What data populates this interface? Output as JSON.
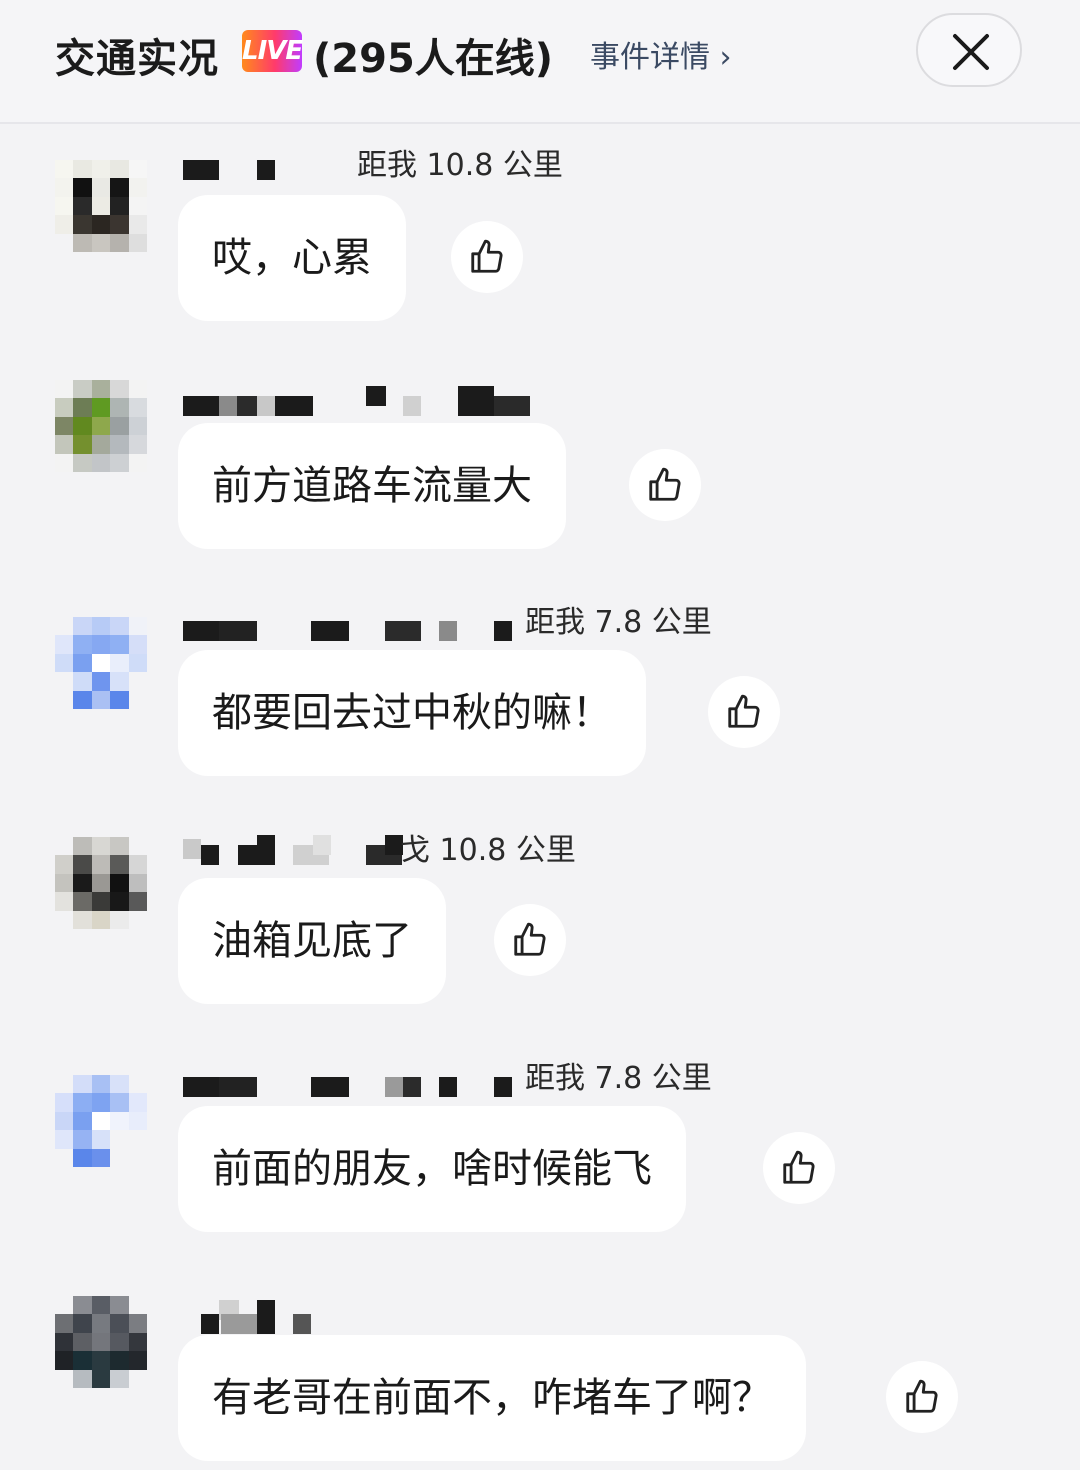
{
  "header": {
    "title": "交通实况",
    "live_badge": "LIVE",
    "online": "(295人在线)",
    "detail_link": "事件详情",
    "detail_chevron": "›",
    "close_icon": "close-icon",
    "live_gradient": [
      "#ff8a1c",
      "#ff3b6b",
      "#c03cff"
    ]
  },
  "comments": [
    {
      "distance": "距我 10.8 公里",
      "text": "哎，心累",
      "like_icon": "thumbs-up-icon"
    },
    {
      "distance": "",
      "text": "前方道路车流量大",
      "like_icon": "thumbs-up-icon"
    },
    {
      "distance": "距我 7.8 公里",
      "text": "都要回去过中秋的嘛！",
      "like_icon": "thumbs-up-icon"
    },
    {
      "distance": "戈 10.8 公里",
      "text": "油箱见底了",
      "like_icon": "thumbs-up-icon"
    },
    {
      "distance": "距我 7.8 公里",
      "text": "前面的朋友，啥时候能飞",
      "like_icon": "thumbs-up-icon"
    },
    {
      "distance": "",
      "text": "有老哥在前面不，咋堵车了啊？",
      "like_icon": "thumbs-up-icon"
    }
  ]
}
